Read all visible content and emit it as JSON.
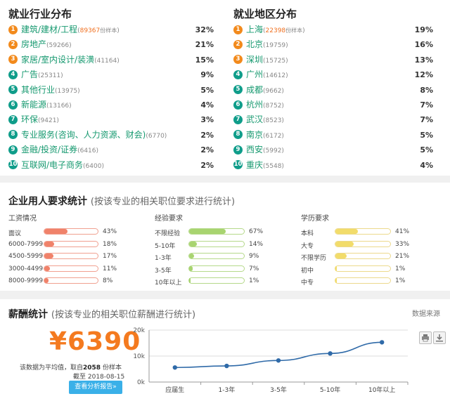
{
  "industry": {
    "title": "就业行业分布",
    "items": [
      {
        "num": "1",
        "name": "建筑/建材/工程",
        "count": "89367",
        "sample": "份样本",
        "pct": "32%"
      },
      {
        "num": "2",
        "name": "房地产",
        "count": "(59266)",
        "pct": "21%"
      },
      {
        "num": "3",
        "name": "家居/室内设计/装潢",
        "count": "(41164)",
        "pct": "15%"
      },
      {
        "num": "4",
        "name": "广告",
        "count": "(25311)",
        "pct": "9%"
      },
      {
        "num": "5",
        "name": "其他行业",
        "count": "(13975)",
        "pct": "5%"
      },
      {
        "num": "6",
        "name": "新能源",
        "count": "(13166)",
        "pct": "4%"
      },
      {
        "num": "7",
        "name": "环保",
        "count": "(9421)",
        "pct": "3%"
      },
      {
        "num": "8",
        "name": "专业服务(咨询、人力资源、财会)",
        "count": "(6770)",
        "pct": "2%"
      },
      {
        "num": "9",
        "name": "金融/投资/证券",
        "count": "(6416)",
        "pct": "2%"
      },
      {
        "num": "10",
        "name": "互联网/电子商务",
        "count": "(6400)",
        "pct": "2%"
      }
    ]
  },
  "region": {
    "title": "就业地区分布",
    "items": [
      {
        "num": "1",
        "name": "上海",
        "count": "22398",
        "sample": "份样本",
        "pct": "19%"
      },
      {
        "num": "2",
        "name": "北京",
        "count": "(19759)",
        "pct": "16%"
      },
      {
        "num": "3",
        "name": "深圳",
        "count": "(15725)",
        "pct": "13%"
      },
      {
        "num": "4",
        "name": "广州",
        "count": "(14612)",
        "pct": "12%"
      },
      {
        "num": "5",
        "name": "成都",
        "count": "(9662)",
        "pct": "8%"
      },
      {
        "num": "6",
        "name": "杭州",
        "count": "(8752)",
        "pct": "7%"
      },
      {
        "num": "7",
        "name": "武汉",
        "count": "(8523)",
        "pct": "7%"
      },
      {
        "num": "8",
        "name": "南京",
        "count": "(6172)",
        "pct": "5%"
      },
      {
        "num": "9",
        "name": "西安",
        "count": "(5992)",
        "pct": "5%"
      },
      {
        "num": "10",
        "name": "重庆",
        "count": "(5548)",
        "pct": "4%"
      }
    ]
  },
  "requirements": {
    "title": "企业用人要求统计",
    "subtitle": "(按该专业的相关职位要求进行统计)",
    "columns": [
      {
        "heading": "工资情况",
        "color": "#f0826a",
        "border": "#f0a090",
        "rows": [
          {
            "label": "面议",
            "pct": "43%",
            "value": 43
          },
          {
            "label": "6000-7999",
            "pct": "18%",
            "value": 18
          },
          {
            "label": "4500-5999",
            "pct": "17%",
            "value": 17
          },
          {
            "label": "3000-4499",
            "pct": "11%",
            "value": 11
          },
          {
            "label": "8000-9999",
            "pct": "8%",
            "value": 8
          }
        ]
      },
      {
        "heading": "经验要求",
        "color": "#a8d470",
        "border": "#b5d98a",
        "rows": [
          {
            "label": "不限经验",
            "pct": "67%",
            "value": 67
          },
          {
            "label": "5-10年",
            "pct": "14%",
            "value": 14
          },
          {
            "label": "1-3年",
            "pct": "9%",
            "value": 9
          },
          {
            "label": "3-5年",
            "pct": "7%",
            "value": 7
          },
          {
            "label": "10年以上",
            "pct": "1%",
            "value": 1
          }
        ]
      },
      {
        "heading": "学历要求",
        "color": "#f2dc6a",
        "border": "#ecd98c",
        "rows": [
          {
            "label": "本科",
            "pct": "41%",
            "value": 41
          },
          {
            "label": "大专",
            "pct": "33%",
            "value": 33
          },
          {
            "label": "不限学历",
            "pct": "21%",
            "value": 21
          },
          {
            "label": "初中",
            "pct": "1%",
            "value": 1
          },
          {
            "label": "中专",
            "pct": "1%",
            "value": 1
          }
        ]
      }
    ]
  },
  "salary": {
    "title": "薪酬统计",
    "subtitle": "(按该专业的相关职位薪酬进行统计)",
    "source_link": "数据来源",
    "amount": "¥6390",
    "note_prefix": "该数据为平均值，取自",
    "note_count": "2058",
    "note_suffix": "份样本",
    "date_line": "截至 2018-08-15",
    "report_button": "查看分析报告»",
    "print_icon": "printer-icon",
    "download_icon": "download-icon"
  },
  "chart_data": {
    "type": "line",
    "categories": [
      "应届生",
      "1-3年",
      "3-5年",
      "5-10年",
      "10年以上"
    ],
    "values": [
      5600,
      6200,
      8300,
      11000,
      15300
    ],
    "yticks": [
      "0k",
      "10k",
      "20k"
    ],
    "ylim": [
      0,
      20000
    ],
    "grid": true,
    "color": "#2f6aa8"
  }
}
